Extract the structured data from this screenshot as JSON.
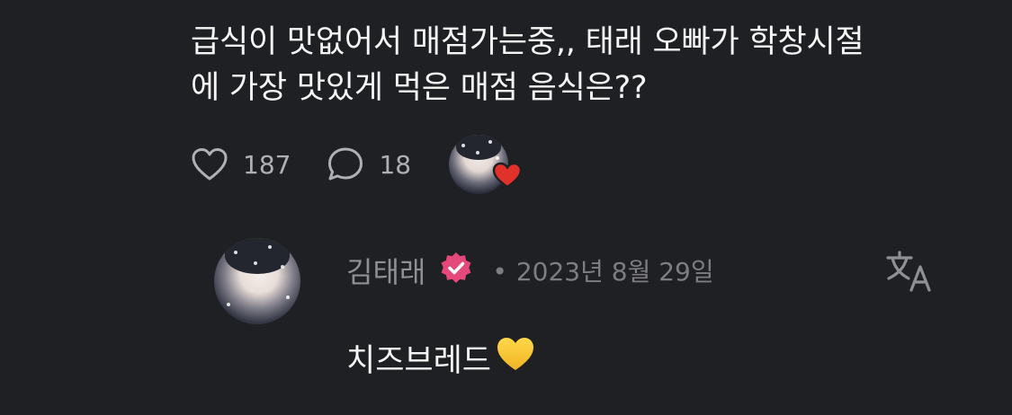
{
  "post": {
    "text": "급식이 맛없어서 매점가는중,, 태래 오빠가 학창시절\n에 가장 맛있게 먹은 매점 음식은??"
  },
  "actions": {
    "likes": "187",
    "comments": "18",
    "like_icon": "heart-outline-icon",
    "comment_icon": "speech-bubble-icon",
    "liked_by_author_badge": "red-heart-icon"
  },
  "comment": {
    "author": "김태래",
    "verified_icon": "verified-badge-icon",
    "separator": "•",
    "date": "2023년 8월 29일",
    "translate_icon": "translate-icon",
    "text": "치즈브레드",
    "emoji": "yellow-heart-icon"
  },
  "colors": {
    "background": "#1f2023",
    "verified": "#e5487a",
    "heart_red": "#e0312a",
    "heart_yellow": "#f5c530"
  }
}
